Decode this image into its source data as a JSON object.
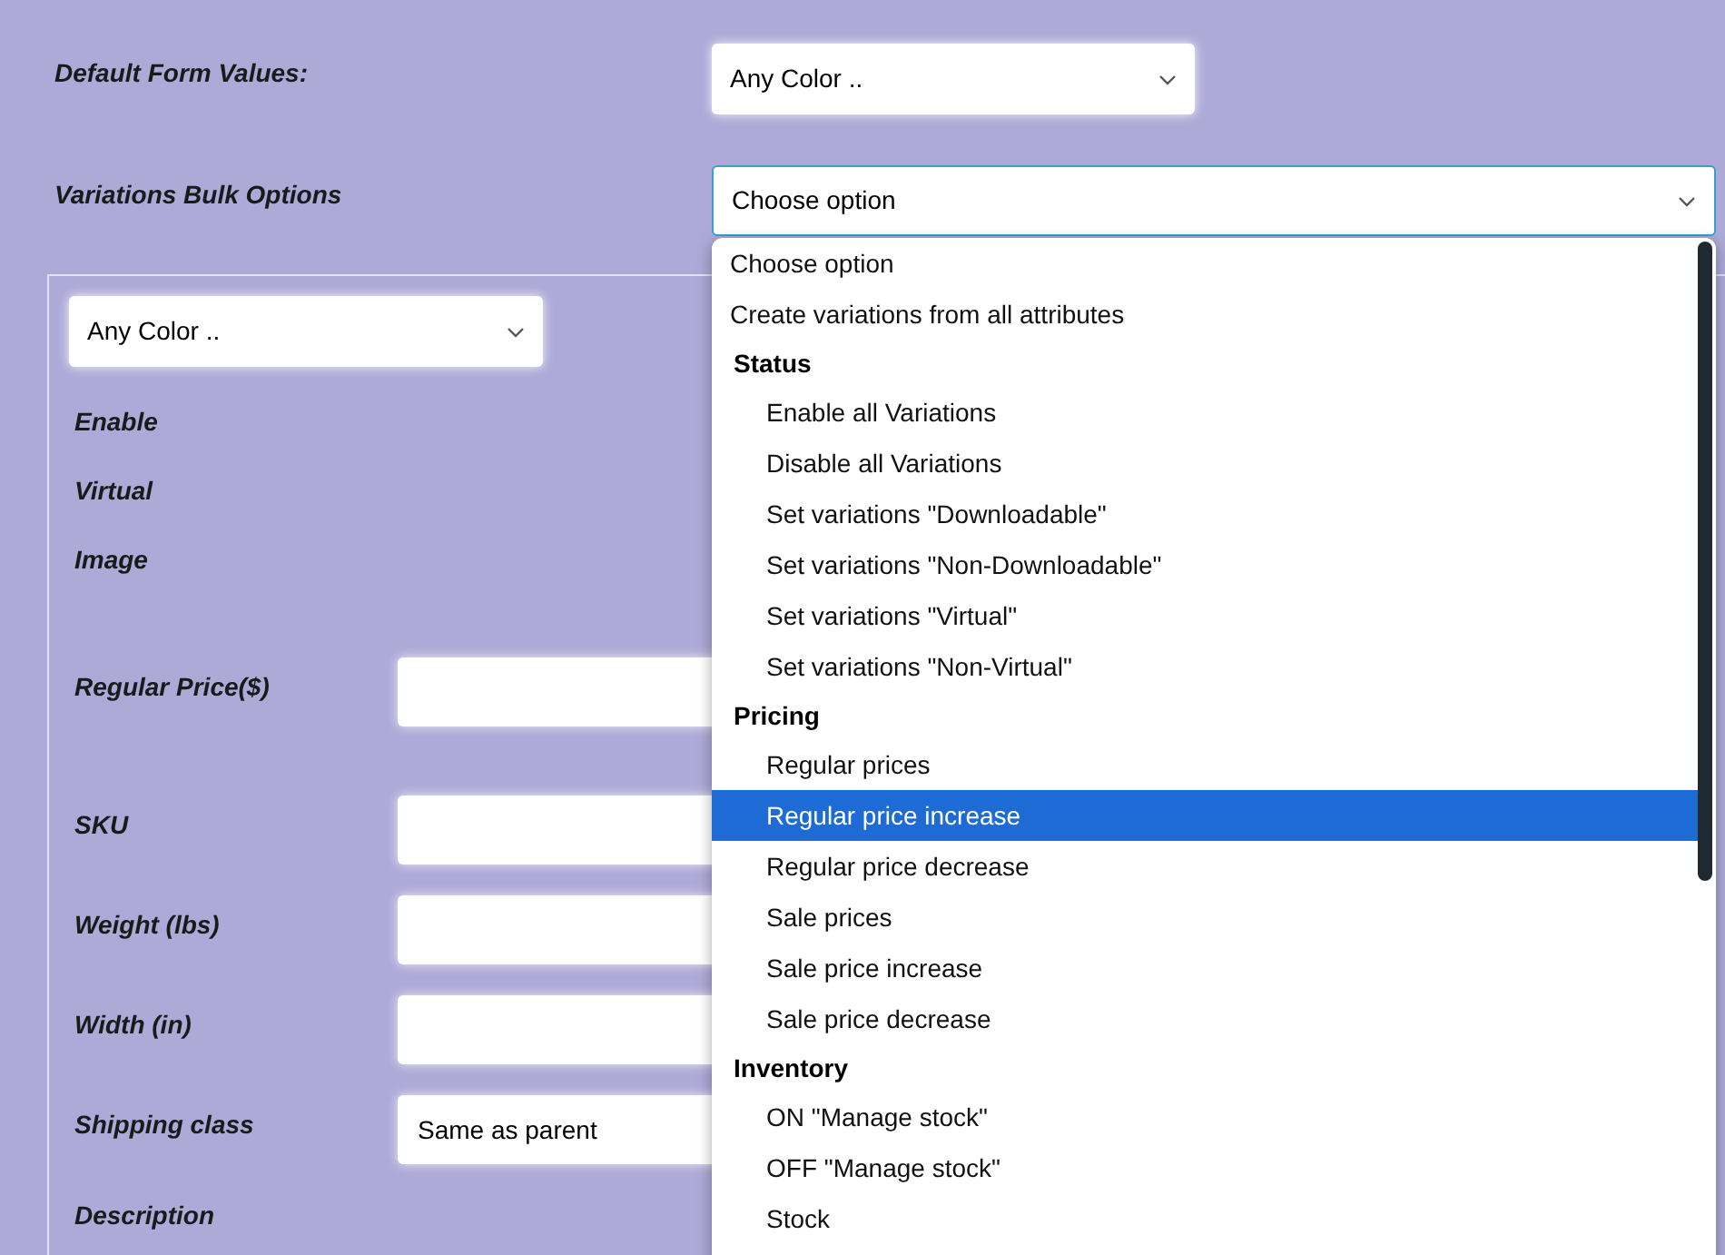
{
  "default_form_values": {
    "label": "Default Form Values:",
    "value": "Any Color .."
  },
  "bulk_options": {
    "label": "Variations Bulk Options",
    "value": "Choose option",
    "expanded": true,
    "options": [
      {
        "kind": "option",
        "label": "Choose option",
        "highlighted": false
      },
      {
        "kind": "option",
        "label": "Create variations from all attributes",
        "highlighted": false
      },
      {
        "kind": "group",
        "label": "Status",
        "children": [
          {
            "label": "Enable all Variations",
            "highlighted": false
          },
          {
            "label": "Disable all Variations",
            "highlighted": false
          },
          {
            "label": "Set variations \"Downloadable\"",
            "highlighted": false
          },
          {
            "label": "Set variations \"Non-Downloadable\"",
            "highlighted": false
          },
          {
            "label": "Set variations \"Virtual\"",
            "highlighted": false
          },
          {
            "label": "Set variations \"Non-Virtual\"",
            "highlighted": false
          }
        ]
      },
      {
        "kind": "group",
        "label": "Pricing",
        "children": [
          {
            "label": "Regular prices",
            "highlighted": false
          },
          {
            "label": "Regular price increase",
            "highlighted": true
          },
          {
            "label": "Regular price decrease",
            "highlighted": false
          },
          {
            "label": "Sale prices",
            "highlighted": false
          },
          {
            "label": "Sale price increase",
            "highlighted": false
          },
          {
            "label": "Sale price decrease",
            "highlighted": false
          }
        ]
      },
      {
        "kind": "group",
        "label": "Inventory",
        "children": [
          {
            "label": "ON \"Manage stock\"",
            "highlighted": false
          },
          {
            "label": "OFF \"Manage stock\"",
            "highlighted": false
          },
          {
            "label": "Stock",
            "highlighted": false
          }
        ]
      }
    ]
  },
  "variation": {
    "attribute_value": "Any Color ..",
    "fields": [
      {
        "kind": "toggle",
        "label": "Enable"
      },
      {
        "kind": "toggle",
        "label": "Virtual"
      },
      {
        "kind": "image",
        "label": "Image"
      },
      {
        "kind": "price",
        "label": "Regular Price($)"
      },
      {
        "kind": "input",
        "label": "SKU"
      },
      {
        "kind": "input",
        "label": "Weight (lbs)"
      },
      {
        "kind": "input",
        "label": "Width (in)"
      },
      {
        "kind": "select",
        "label": "Shipping class",
        "value": "Same as parent"
      },
      {
        "kind": "text",
        "label": "Description"
      }
    ]
  }
}
